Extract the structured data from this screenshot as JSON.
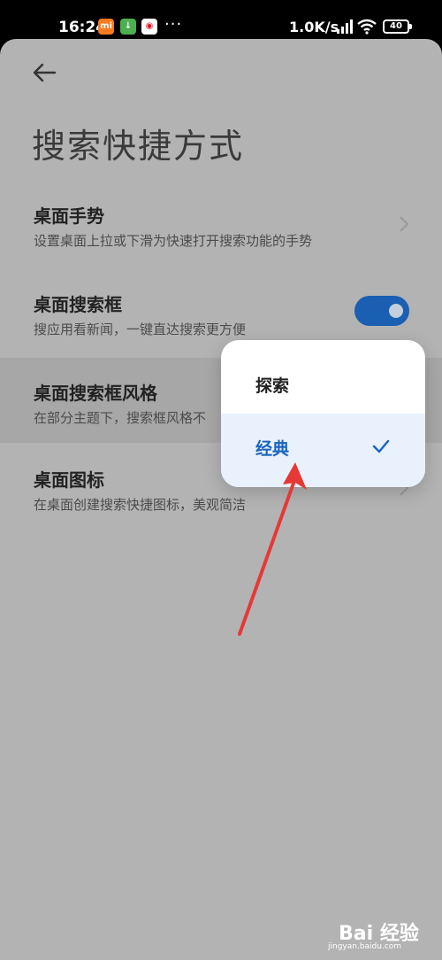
{
  "status_bar": {
    "time": "16:24",
    "app_icons": [
      {
        "name": "mi-app-icon",
        "text": "mi",
        "color": "#f47b20"
      },
      {
        "name": "download-icon",
        "text": "↓",
        "color": "#4caf50"
      },
      {
        "name": "weibo-icon",
        "text": "◉",
        "color": "#e6162d"
      }
    ],
    "more": "···",
    "net_speed": "1.0K/s",
    "battery": "40"
  },
  "page": {
    "title": "搜索快捷方式"
  },
  "settings": [
    {
      "title": "桌面手势",
      "desc": "设置桌面上拉或下滑为快速打开搜索功能的手势"
    },
    {
      "title": "桌面搜索框",
      "desc": "搜应用看新闻，一键直达搜索更方便",
      "toggle_on": true
    },
    {
      "title": "桌面搜索框风格",
      "desc": "在部分主题下，搜索框风格不"
    },
    {
      "title": "桌面图标",
      "desc": "在桌面创建搜索快捷图标，美观简洁"
    }
  ],
  "menu": {
    "options": [
      {
        "label": "探索",
        "selected": false
      },
      {
        "label": "经典",
        "selected": true
      }
    ]
  },
  "watermark": {
    "brand": "Bai 经验",
    "url": "jingyan.baidu.com"
  },
  "colors": {
    "accent": "#1a64bd",
    "annotation_arrow": "#e53935"
  }
}
